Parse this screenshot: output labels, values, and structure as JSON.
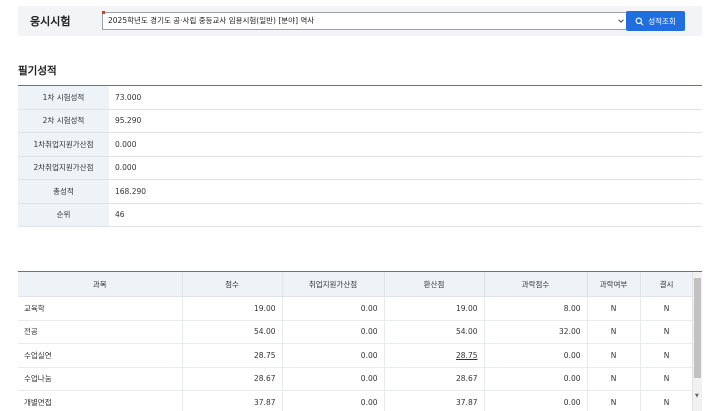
{
  "exam_selector": {
    "label": "응시시험",
    "selected": "2025학년도 경기도 공·사립 중등교사 임용시험(일반) [분야] 역사",
    "search_button": "성적조회"
  },
  "written_scores": {
    "title": "필기성적",
    "rows": [
      {
        "label": "1차 시험성적",
        "value": "73.000"
      },
      {
        "label": "2차 시험성적",
        "value": "95.290"
      },
      {
        "label": "1차취업지원가산점",
        "value": "0.000"
      },
      {
        "label": "2차취업지원가산점",
        "value": "0.000"
      },
      {
        "label": "총성적",
        "value": "168.290"
      },
      {
        "label": "순위",
        "value": "46"
      }
    ]
  },
  "subject_table": {
    "headers": [
      "과목",
      "점수",
      "취업지원가산점",
      "환산점",
      "과락점수",
      "과락여부",
      "결시"
    ],
    "rows": [
      [
        "교육학",
        "19.00",
        "0.00",
        "19.00",
        "8.00",
        "N",
        "N"
      ],
      [
        "전공",
        "54.00",
        "0.00",
        "54.00",
        "32.00",
        "N",
        "N"
      ],
      [
        "수업실연",
        "28.75",
        "0.00",
        "28.75",
        "0.00",
        "N",
        "N"
      ],
      [
        "수업나눔",
        "28.67",
        "0.00",
        "28.67",
        "0.00",
        "N",
        "N"
      ],
      [
        "개별면접",
        "37.87",
        "0.00",
        "37.87",
        "0.00",
        "N",
        "N"
      ]
    ]
  },
  "colors": {
    "accent": "#1f6fe0",
    "header_bg": "#eef3f7"
  }
}
